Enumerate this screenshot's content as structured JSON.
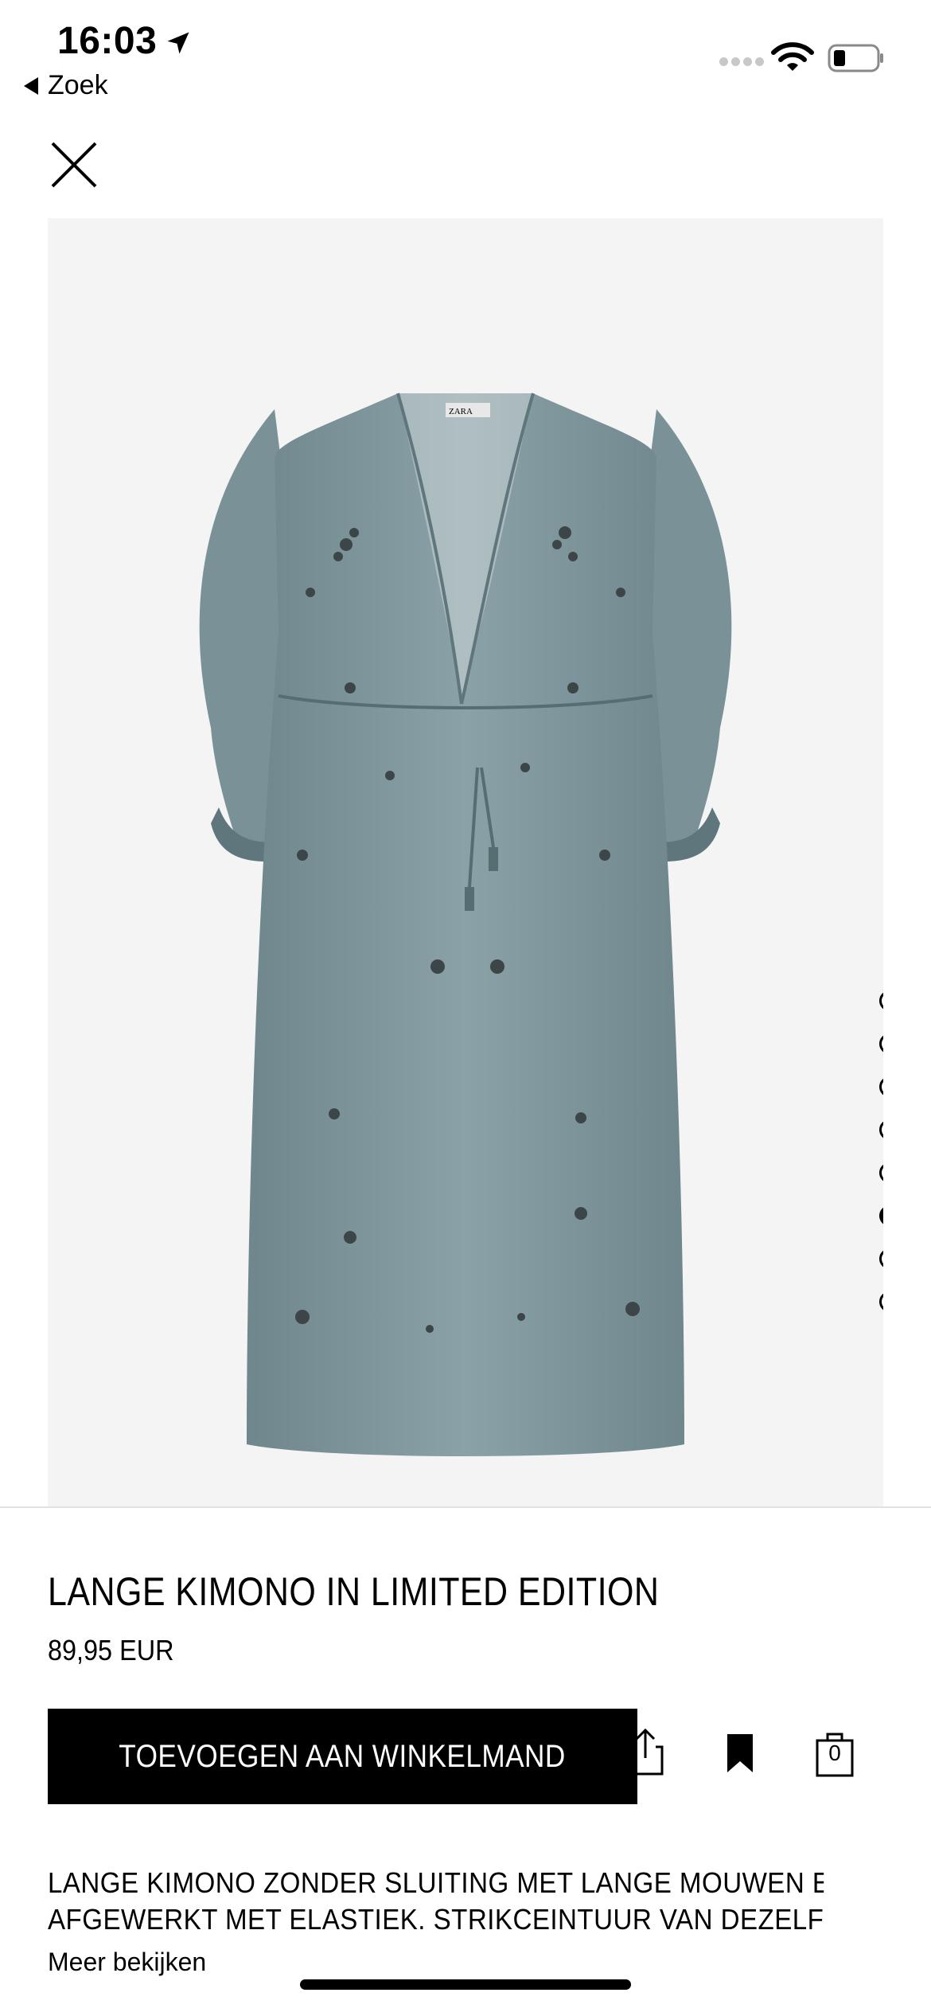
{
  "status": {
    "time": "16:03",
    "back_label": "Zoek"
  },
  "product": {
    "title": "LANGE KIMONO IN LIMITED EDITION",
    "price": "89,95 EUR",
    "add_to_cart_label": "TOEVOEGEN AAN WINKELMAND",
    "cart_count": "0",
    "description_line1": "LANGE KIMONO ZONDER SLUITING MET LANGE MOUWEN EN",
    "description_line2": "AFGEWERKT MET ELASTIEK. STRIKCEINTUUR VAN DEZELFDE ST…",
    "more_label": "Meer bekijken",
    "garment_label": "ZARA"
  },
  "gallery": {
    "image_count": 8,
    "active_index": 5
  },
  "colors": {
    "garment": "#7f979c",
    "gallery_bg": "#f4f4f4",
    "button_bg": "#000000"
  },
  "icons": [
    "location-arrow-icon",
    "back-triangle-icon",
    "cellular-signal-icon",
    "wifi-icon",
    "battery-icon",
    "close-icon",
    "share-icon",
    "bookmark-icon",
    "shopping-bag-icon"
  ]
}
